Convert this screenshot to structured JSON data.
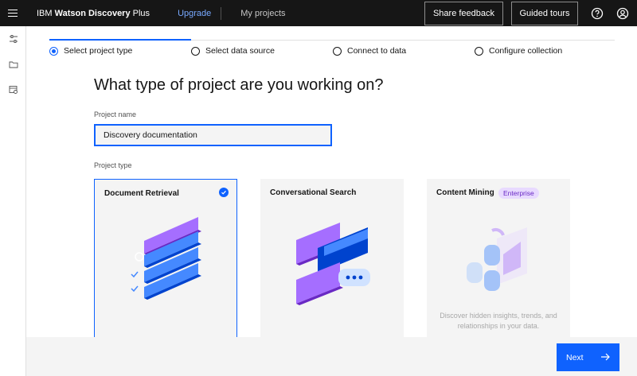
{
  "header": {
    "brand_prefix": "IBM ",
    "brand_bold": "Watson Discovery",
    "brand_suffix": " Plus",
    "upgrade": "Upgrade",
    "my_projects": "My projects",
    "share_feedback": "Share feedback",
    "guided_tours": "Guided tours",
    "icons": [
      "menu-icon",
      "help-icon",
      "user-icon"
    ]
  },
  "rail": {
    "icons": [
      "settings-sliders-icon",
      "folder-icon",
      "data-settings-icon"
    ]
  },
  "steps": [
    {
      "label": "Select project type",
      "active": true
    },
    {
      "label": "Select data source",
      "active": false
    },
    {
      "label": "Connect to data",
      "active": false
    },
    {
      "label": "Configure collection",
      "active": false
    }
  ],
  "title": "What type of project are you working on?",
  "project_name": {
    "label": "Project name",
    "value": "Discovery documentation"
  },
  "project_type_label": "Project type",
  "cards": [
    {
      "title": "Document Retrieval",
      "selected": true,
      "description": ""
    },
    {
      "title": "Conversational Search",
      "selected": false,
      "description": ""
    },
    {
      "title": "Content Mining",
      "selected": false,
      "tag": "Enterprise",
      "description": "Discover hidden insights, trends, and relationships in your data."
    }
  ],
  "footer": {
    "next_label": "Next"
  },
  "colors": {
    "accent": "#0f62fe",
    "header_bg": "#161616",
    "link": "#78a9ff",
    "tag_bg": "#e8daff",
    "tag_text": "#6929c4"
  }
}
